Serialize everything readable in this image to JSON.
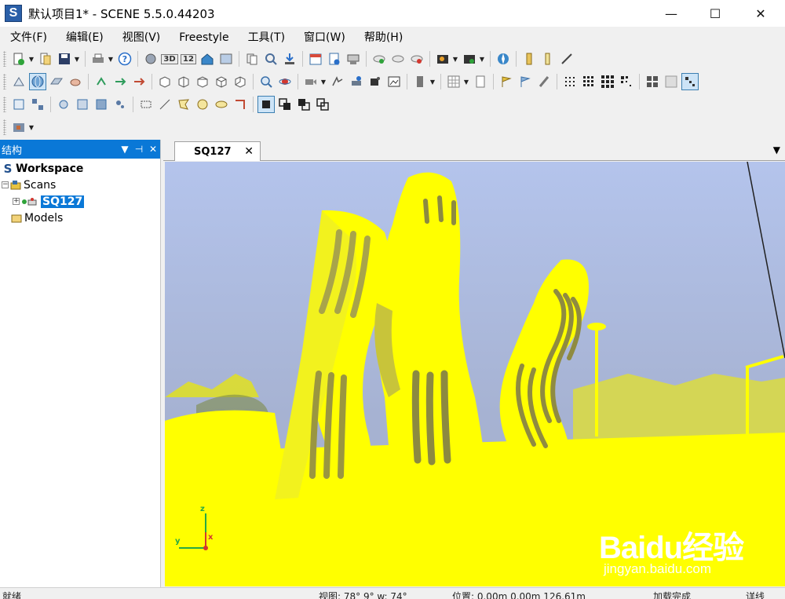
{
  "window": {
    "title": "默认项目1* - SCENE 5.5.0.44203",
    "app_icon_letter": "S",
    "minimize": "—",
    "maximize": "☐",
    "close": "✕"
  },
  "menu": [
    "文件(F)",
    "编辑(E)",
    "视图(V)",
    "Freestyle",
    "工具(T)",
    "窗口(W)",
    "帮助(H)"
  ],
  "toolbar1_text": {
    "view3d": "3D",
    "view12": "12"
  },
  "panel": {
    "title": "结构",
    "dropdown": "▼",
    "pin": "⊣",
    "close": "✕"
  },
  "tree": {
    "workspace_icon": "S",
    "workspace": "Workspace",
    "scans": "Scans",
    "scan_item": "SQ127",
    "models": "Models",
    "expander_minus": "−",
    "expander_plus": "+"
  },
  "tab": {
    "label": "SQ127",
    "close": "✕",
    "menu": "▼"
  },
  "axes": {
    "z": "z",
    "y": "y",
    "x": "x"
  },
  "watermark": {
    "logo": "Baidu经验",
    "url": "jingyan.baidu.com"
  },
  "status": {
    "ready": "就绪",
    "view": "视图:  78° 9° w:  74°",
    "position": "位置:  0.00m 0.00m 126.61m",
    "load": "加载完成",
    "detail": "详线"
  },
  "colors": {
    "accent": "#0a78d7",
    "pointcloud": "#ffff00",
    "sky": "#b4c4ec"
  },
  "icons": [
    "new-project-icon",
    "open-icon",
    "save-icon",
    "print-icon",
    "help-icon",
    "view3d-icon",
    "view12-icon",
    "home-view-icon",
    "select-icon",
    "globe-view-icon",
    "planar-view-icon",
    "measure-icon",
    "cube-view-icon",
    "zoom-icon",
    "camera-icon",
    "grid-icon",
    "flag-icon",
    "dots-small-icon",
    "dots-large-icon",
    "cluster-icon",
    "select-rect-icon",
    "select-line-icon",
    "select-polygon-icon",
    "select-circle-icon",
    "select-ellipse-icon",
    "clip-inside-icon",
    "clip-outside-icon",
    "layer-icon"
  ]
}
